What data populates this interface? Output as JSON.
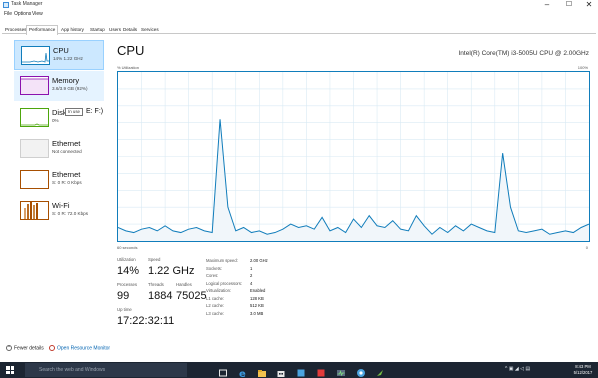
{
  "window": {
    "title": "Task Manager",
    "controls": {
      "minimize": "–",
      "maximize": "☐",
      "close": "✕"
    }
  },
  "menu": [
    "File",
    "Options",
    "View"
  ],
  "tabs": [
    "Processes",
    "Performance",
    "App history",
    "Startup",
    "Users",
    "Details",
    "Services"
  ],
  "active_tab": "Performance",
  "sidebar": {
    "items": [
      {
        "title": "CPU",
        "sub": "14% 1.22 GHz",
        "color": "#117dbb"
      },
      {
        "title": "Memory",
        "sub": "3.6/3.9 GB (92%)",
        "color": "#8b12ae"
      },
      {
        "title": "Disk",
        "sub": "0%",
        "suffix": "E: F:)",
        "color": "#4da60c"
      },
      {
        "title": "Ethernet",
        "sub": "Not connected",
        "color": "#a74f01"
      },
      {
        "title": "Ethernet",
        "sub": "S: 0 R: 0 Kbps",
        "color": "#a74f01"
      },
      {
        "title": "Wi-Fi",
        "sub": "S: 0 R: 72.0 Kbps",
        "color": "#a74f01"
      }
    ],
    "tooltip": "In use"
  },
  "main": {
    "title": "CPU",
    "cpu_name": "Intel(R) Core(TM) i3-5005U CPU @ 2.00GHz",
    "y_axis_label": "% Utilization",
    "y_axis_max": "100%",
    "x_axis_label": "60 seconds",
    "x_axis_min": "0"
  },
  "stats": {
    "utilization": {
      "label": "Utilization",
      "value": "14%"
    },
    "speed": {
      "label": "Speed",
      "value": "1.22 GHz"
    },
    "processes": {
      "label": "Processes",
      "value": "99"
    },
    "threads": {
      "label": "Threads",
      "value": "1884"
    },
    "handles": {
      "label": "Handles",
      "value": "75025"
    },
    "uptime": {
      "label": "Up time",
      "value": "17:22:32:11"
    },
    "details": [
      {
        "key": "Maximum speed:",
        "value": "2.00 GHz"
      },
      {
        "key": "Sockets:",
        "value": "1"
      },
      {
        "key": "Cores:",
        "value": "2"
      },
      {
        "key": "Logical processors:",
        "value": "4"
      },
      {
        "key": "Virtualization:",
        "value": "Enabled"
      },
      {
        "key": "L1 cache:",
        "value": "128 KB"
      },
      {
        "key": "L2 cache:",
        "value": "512 KB"
      },
      {
        "key": "L3 cache:",
        "value": "3.0 MB"
      }
    ]
  },
  "footer": {
    "fewer_details": "Fewer details",
    "open_monitor": "Open Resource Monitor"
  },
  "taskbar": {
    "search_placeholder": "Search the web and Windows",
    "time": "8:43 PM",
    "date": "5/12/2017"
  },
  "chart_data": {
    "type": "area",
    "title": "",
    "ylabel": "% Utilization",
    "xlabel": "60 seconds",
    "ylim": [
      0,
      100
    ],
    "x_direction": "seconds ago, 60 → 0",
    "x": [
      60,
      59,
      58,
      57,
      56,
      55,
      54,
      53,
      52,
      51,
      50,
      49,
      48,
      47,
      46,
      45,
      44,
      43,
      42,
      41,
      40,
      39,
      38,
      37,
      36,
      35,
      34,
      33,
      32,
      31,
      30,
      29,
      28,
      27,
      26,
      25,
      24,
      23,
      22,
      21,
      20,
      19,
      18,
      17,
      16,
      15,
      14,
      13,
      12,
      11,
      10,
      9,
      8,
      7,
      6,
      5,
      4,
      3,
      2,
      1,
      0
    ],
    "values": [
      8,
      6,
      5,
      7,
      8,
      6,
      9,
      6,
      5,
      7,
      8,
      6,
      5,
      72,
      20,
      6,
      8,
      5,
      6,
      4,
      5,
      7,
      10,
      8,
      9,
      7,
      14,
      6,
      8,
      5,
      13,
      8,
      15,
      9,
      8,
      12,
      7,
      6,
      15,
      9,
      4,
      8,
      5,
      9,
      6,
      10,
      8,
      6,
      5,
      52,
      20,
      6,
      5,
      6,
      7,
      4,
      5,
      6,
      5,
      8,
      10
    ],
    "series": [
      {
        "name": "CPU",
        "color": "#117dbb",
        "fill": "#f1f6fa"
      }
    ],
    "grid": true
  }
}
